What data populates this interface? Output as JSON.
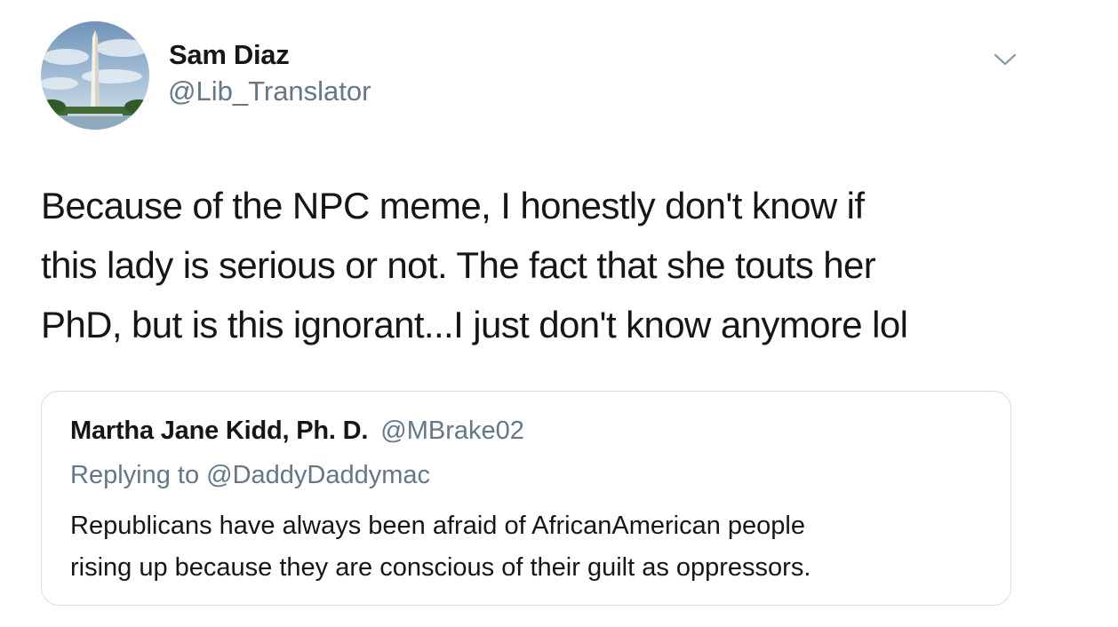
{
  "tweet": {
    "author": {
      "display_name": "Sam Diaz",
      "handle": "@Lib_Translator",
      "avatar_icon": "washington-monument-avatar"
    },
    "menu_icon": "chevron-down-icon",
    "text_lines": [
      "Because of the NPC meme, I honestly don't know if",
      "this lady is serious or not. The fact that she touts her",
      "PhD, but is this ignorant...I just don't know anymore lol"
    ]
  },
  "quoted_tweet": {
    "display_name": "Martha Jane Kidd, Ph. D.",
    "handle": "@MBrake02",
    "replying_to": "Replying to @DaddyDaddymac",
    "text_lines": [
      "Republicans have always been afraid of AfricanAmerican people",
      "rising up because they are conscious of their guilt as oppressors."
    ]
  },
  "colors": {
    "primary_text": "#14171a",
    "secondary_text": "#657786",
    "border": "#d5dde3",
    "background": "#ffffff"
  }
}
